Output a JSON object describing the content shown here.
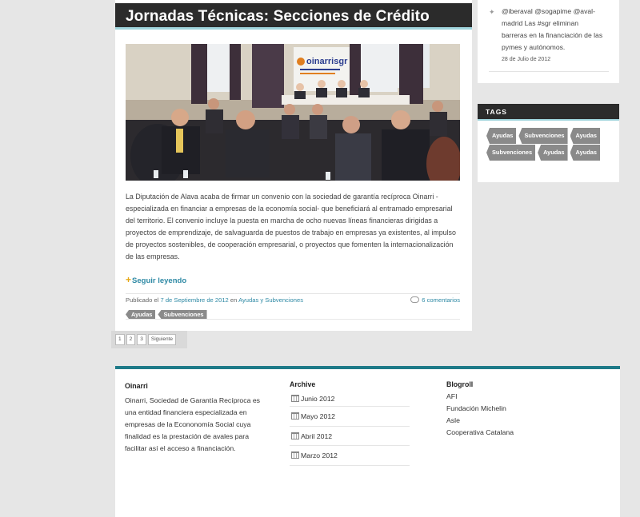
{
  "post": {
    "title": "Jornadas Técnicas: Secciones de Crédito",
    "banner_logo": "oinarrisgr",
    "body": "La Diputación de Alava acaba de firmar un convenio con la sociedad de garantía recíproca Oinarri -especializada en financiar a empresas de la economía social- que beneficiará al entramado empresarial del territorio. El convenio incluye la puesta en marcha de ocho nuevas líneas financieras dirigidas a proyectos de emprendizaje, de salvaguarda de puestos de trabajo en empresas ya existentes, al impulso de proyectos sostenibles, de cooperación empresarial, o proyectos que fomenten la internacionalización de las empresas.",
    "read_more": "Seguir leyendo",
    "published_prefix": "Publicado el",
    "published_date": "7 de Septiembre de 2012",
    "in_word": "en",
    "category": "Ayudas y Subvenciones",
    "comments": "6 comentarios",
    "tags": [
      "Ayudas",
      "Subvenciones"
    ]
  },
  "pagination": {
    "pages": [
      "1",
      "2",
      "3"
    ],
    "next": "Siguiente"
  },
  "sidebar": {
    "tweet": {
      "text": "@iberaval @sogapime @aval-madrid Las #sgr eliminan barreras en la financiación de las pymes y autónomos.",
      "date": "28 de Julio de 2012"
    },
    "tags_title": "TAGS",
    "tags": [
      "Ayudas",
      "Subvenciones",
      "Ayudas",
      "Subvenciones",
      "Ayudas",
      "Ayudas"
    ]
  },
  "footer": {
    "about": {
      "title": "Oinarri",
      "text": "Oinarri, Sociedad de Garantía Recíproca es una entidad financiera especializada en empresas de la Econonomía Social cuya finalidad es la prestación de avales para facilitar así el acceso a financiación."
    },
    "archive": {
      "title": "Archive",
      "items": [
        "Junio 2012",
        "Mayo 2012",
        "Abril 2012",
        "Marzo 2012"
      ]
    },
    "blogroll": {
      "title": "Blogroll",
      "items": [
        "AFI",
        "Fundación Michelin",
        "Asle",
        "Cooperativa Catalana"
      ]
    }
  },
  "colors": {
    "accent": "#2f8aa5",
    "header_bg": "#2b2b2b",
    "footer_bar": "#1e7a88"
  }
}
